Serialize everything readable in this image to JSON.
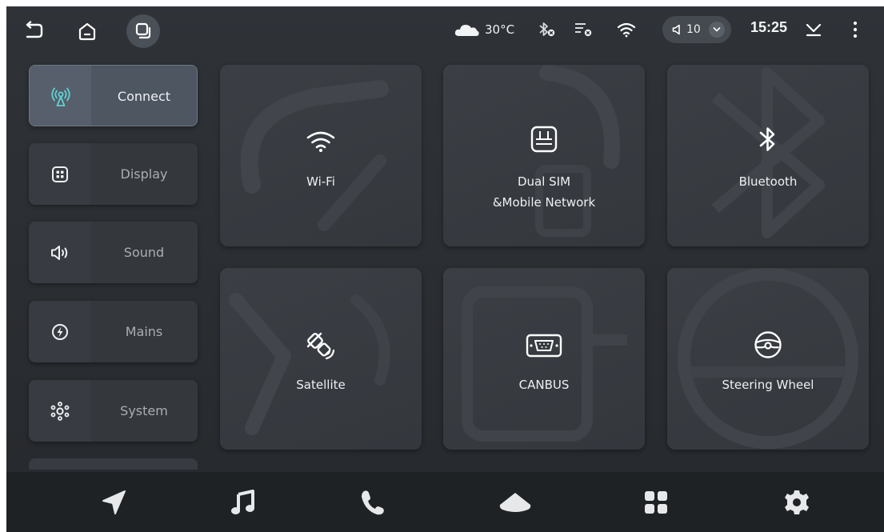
{
  "status_bar": {
    "temperature": "30°C",
    "volume_value": "10",
    "time": "15:25"
  },
  "sidebar": {
    "items": [
      {
        "label": "Connect",
        "icon": "connect-icon",
        "active": true
      },
      {
        "label": "Display",
        "icon": "display-icon",
        "active": false
      },
      {
        "label": "Sound",
        "icon": "speaker-icon",
        "active": false
      },
      {
        "label": "Mains",
        "icon": "lightning-icon",
        "active": false
      },
      {
        "label": "System",
        "icon": "system-icon",
        "active": false
      }
    ]
  },
  "tiles": [
    {
      "label": "Wi-Fi",
      "label2": "",
      "icon": "wifi-icon"
    },
    {
      "label": "Dual SIM",
      "label2": "&Mobile Network",
      "icon": "sim-icon"
    },
    {
      "label": "Bluetooth",
      "label2": "",
      "icon": "bluetooth-icon"
    },
    {
      "label": "Satellite",
      "label2": "",
      "icon": "satellite-icon"
    },
    {
      "label": "CANBUS",
      "label2": "",
      "icon": "canbus-icon"
    },
    {
      "label": "Steering Wheel",
      "label2": "",
      "icon": "steering-wheel-icon"
    }
  ],
  "dock": {
    "items": [
      "navigation-icon",
      "music-icon",
      "phone-icon",
      "home-icon",
      "apps-icon",
      "settings-icon"
    ]
  },
  "colors": {
    "background": "#2c2f34",
    "tile": "#383c42",
    "active_item": "#4e5662",
    "accent_teal": "#5fd3d6",
    "dock": "#1f2225"
  }
}
